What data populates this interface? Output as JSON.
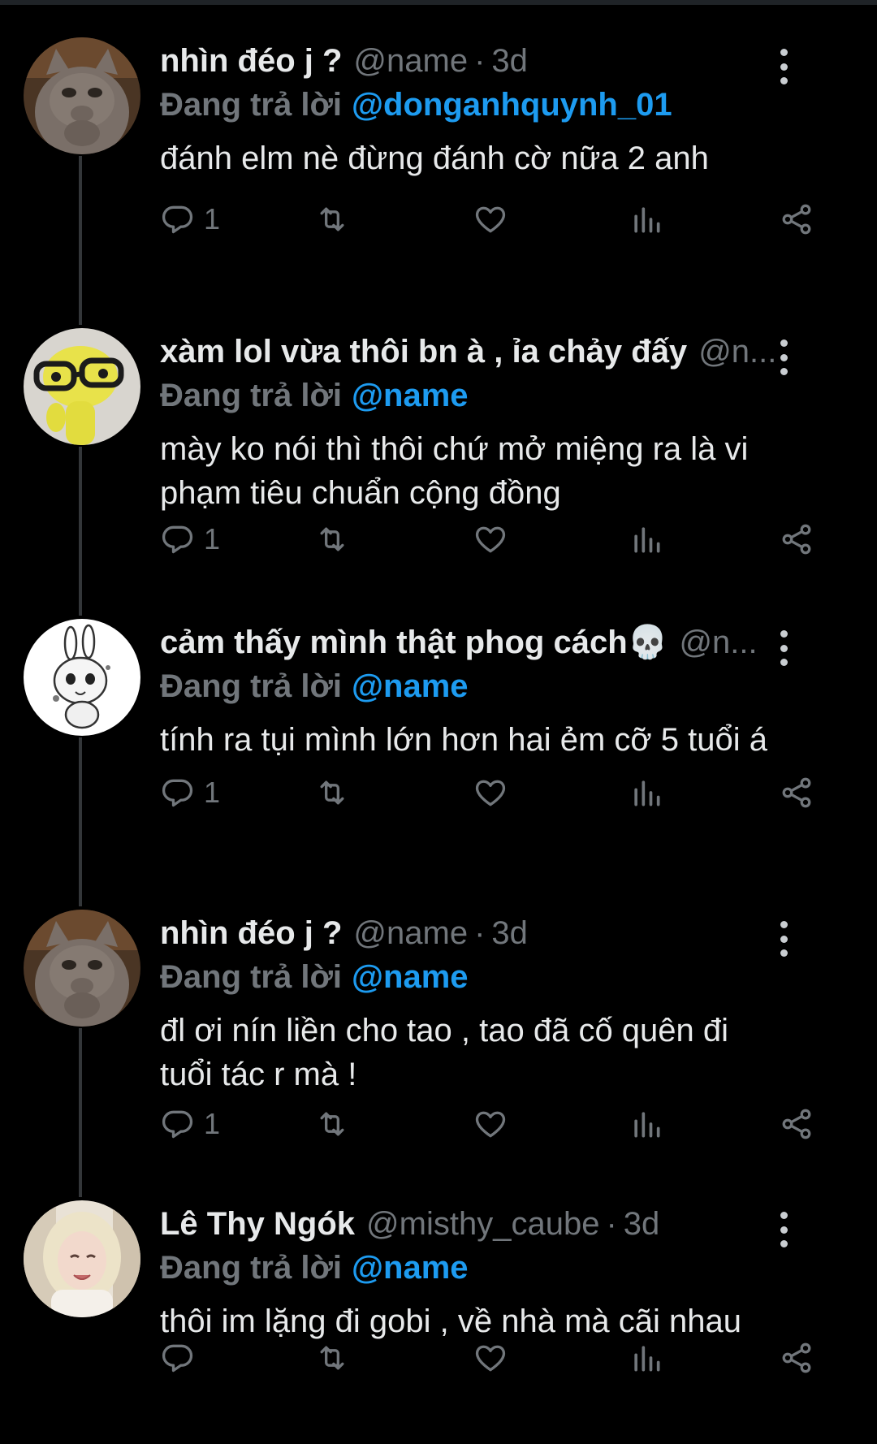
{
  "reply_prefix": "Đang trả lời",
  "tweets": [
    {
      "name": "nhìn đéo j ?",
      "handle": "@name",
      "sep": "·",
      "time": "3d",
      "reply_to": "@donganhquynh_01",
      "lines": [
        "đánh elm nè đừng đánh cờ nữa 2 anh"
      ],
      "reply_count": "1",
      "avatar": "gray-cat"
    },
    {
      "name": "xàm lol vừa thôi bn à , ỉa chảy đấy",
      "handle": "@n...",
      "sep": "",
      "time": "",
      "reply_to": "@name",
      "lines": [
        "mày ko nói thì thôi chứ mở miệng ra là vi",
        "phạm tiêu chuẩn cộng đồng"
      ],
      "reply_count": "1",
      "avatar": "yellow-figure-glasses"
    },
    {
      "name": "cảm thấy mình thật phog cách💀",
      "handle": "@n...",
      "sep": "",
      "time": "",
      "reply_to": "@name",
      "lines": [
        "tính ra tụi mình lớn hơn hai ẻm cỡ 5 tuổi á"
      ],
      "reply_count": "1",
      "avatar": "sketch-bunny"
    },
    {
      "name": "nhìn đéo j ?",
      "handle": "@name",
      "sep": "·",
      "time": "3d",
      "reply_to": "@name",
      "lines": [
        "đl ơi nín liền cho tao , tao đã cố quên đi",
        "tuổi tác r mà !"
      ],
      "reply_count": "1",
      "avatar": "gray-cat"
    },
    {
      "name": "Lê Thy Ngók",
      "handle": "@misthy_caube",
      "sep": "·",
      "time": "3d",
      "reply_to": "@name",
      "lines": [
        "thôi im lặng đi gobi  , về nhà mà cãi nhau"
      ],
      "reply_count": "",
      "avatar": "blonde-girl"
    }
  ],
  "colors": {
    "background": "#000000",
    "text": "#e7e9ea",
    "muted": "#71767b",
    "link": "#1d9bf0",
    "thread_line": "#333639"
  }
}
